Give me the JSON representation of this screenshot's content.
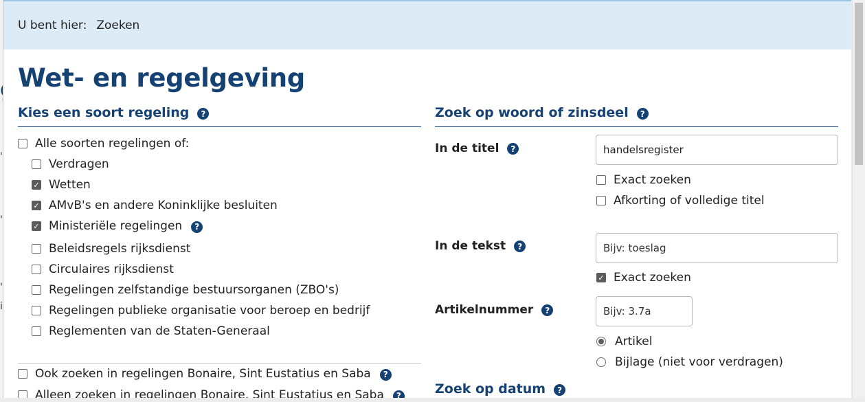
{
  "breadcrumb": {
    "prefix": "U bent hier:",
    "current": "Zoeken"
  },
  "title": "Wet- en regelgeving",
  "left": {
    "heading": "Kies een soort regeling",
    "all": {
      "label": "Alle soorten regelingen of:",
      "checked": false
    },
    "options": [
      {
        "label": "Verdragen",
        "checked": false,
        "help": false
      },
      {
        "label": "Wetten",
        "checked": true,
        "help": false
      },
      {
        "label": "AMvB's en andere Koninklijke besluiten",
        "checked": true,
        "help": false
      },
      {
        "label": "Ministeriële regelingen",
        "checked": true,
        "help": true
      },
      {
        "label": "Beleidsregels rijksdienst",
        "checked": false,
        "help": false
      },
      {
        "label": "Circulaires rijksdienst",
        "checked": false,
        "help": false
      },
      {
        "label": "Regelingen zelfstandige bestuursorganen (ZBO's)",
        "checked": false,
        "help": false
      },
      {
        "label": "Regelingen publieke organisatie voor beroep en bedrijf",
        "checked": false,
        "help": false
      },
      {
        "label": "Reglementen van de Staten-Generaal",
        "checked": false,
        "help": false
      }
    ],
    "bes1": {
      "label": "Ook zoeken in regelingen Bonaire, Sint Eustatius en Saba",
      "checked": false
    },
    "bes2": {
      "label": "Alleen zoeken in regelingen Bonaire, Sint Eustatius en Saba",
      "checked": false
    }
  },
  "right": {
    "heading": "Zoek op woord of zinsdeel",
    "title_field": {
      "label": "In de titel",
      "value": "handelsregister",
      "exact": {
        "label": "Exact zoeken",
        "checked": false
      },
      "abbrev": {
        "label": "Afkorting of volledige titel",
        "checked": false
      }
    },
    "text_field": {
      "label": "In de tekst",
      "placeholder": "Bijv: toeslag",
      "exact": {
        "label": "Exact zoeken",
        "checked": true
      }
    },
    "article_field": {
      "label": "Artikelnummer",
      "placeholder": "Bijv: 3.7a",
      "radio_article": {
        "label": "Artikel",
        "selected": true
      },
      "radio_annex": {
        "label": "Bijlage (niet voor verdragen)",
        "selected": false
      }
    },
    "date_heading": "Zoek op datum"
  },
  "help_glyph": "?",
  "check_glyph": "✓",
  "bg_glyphs": [
    "g",
    "'",
    "'",
    "'",
    "i"
  ]
}
